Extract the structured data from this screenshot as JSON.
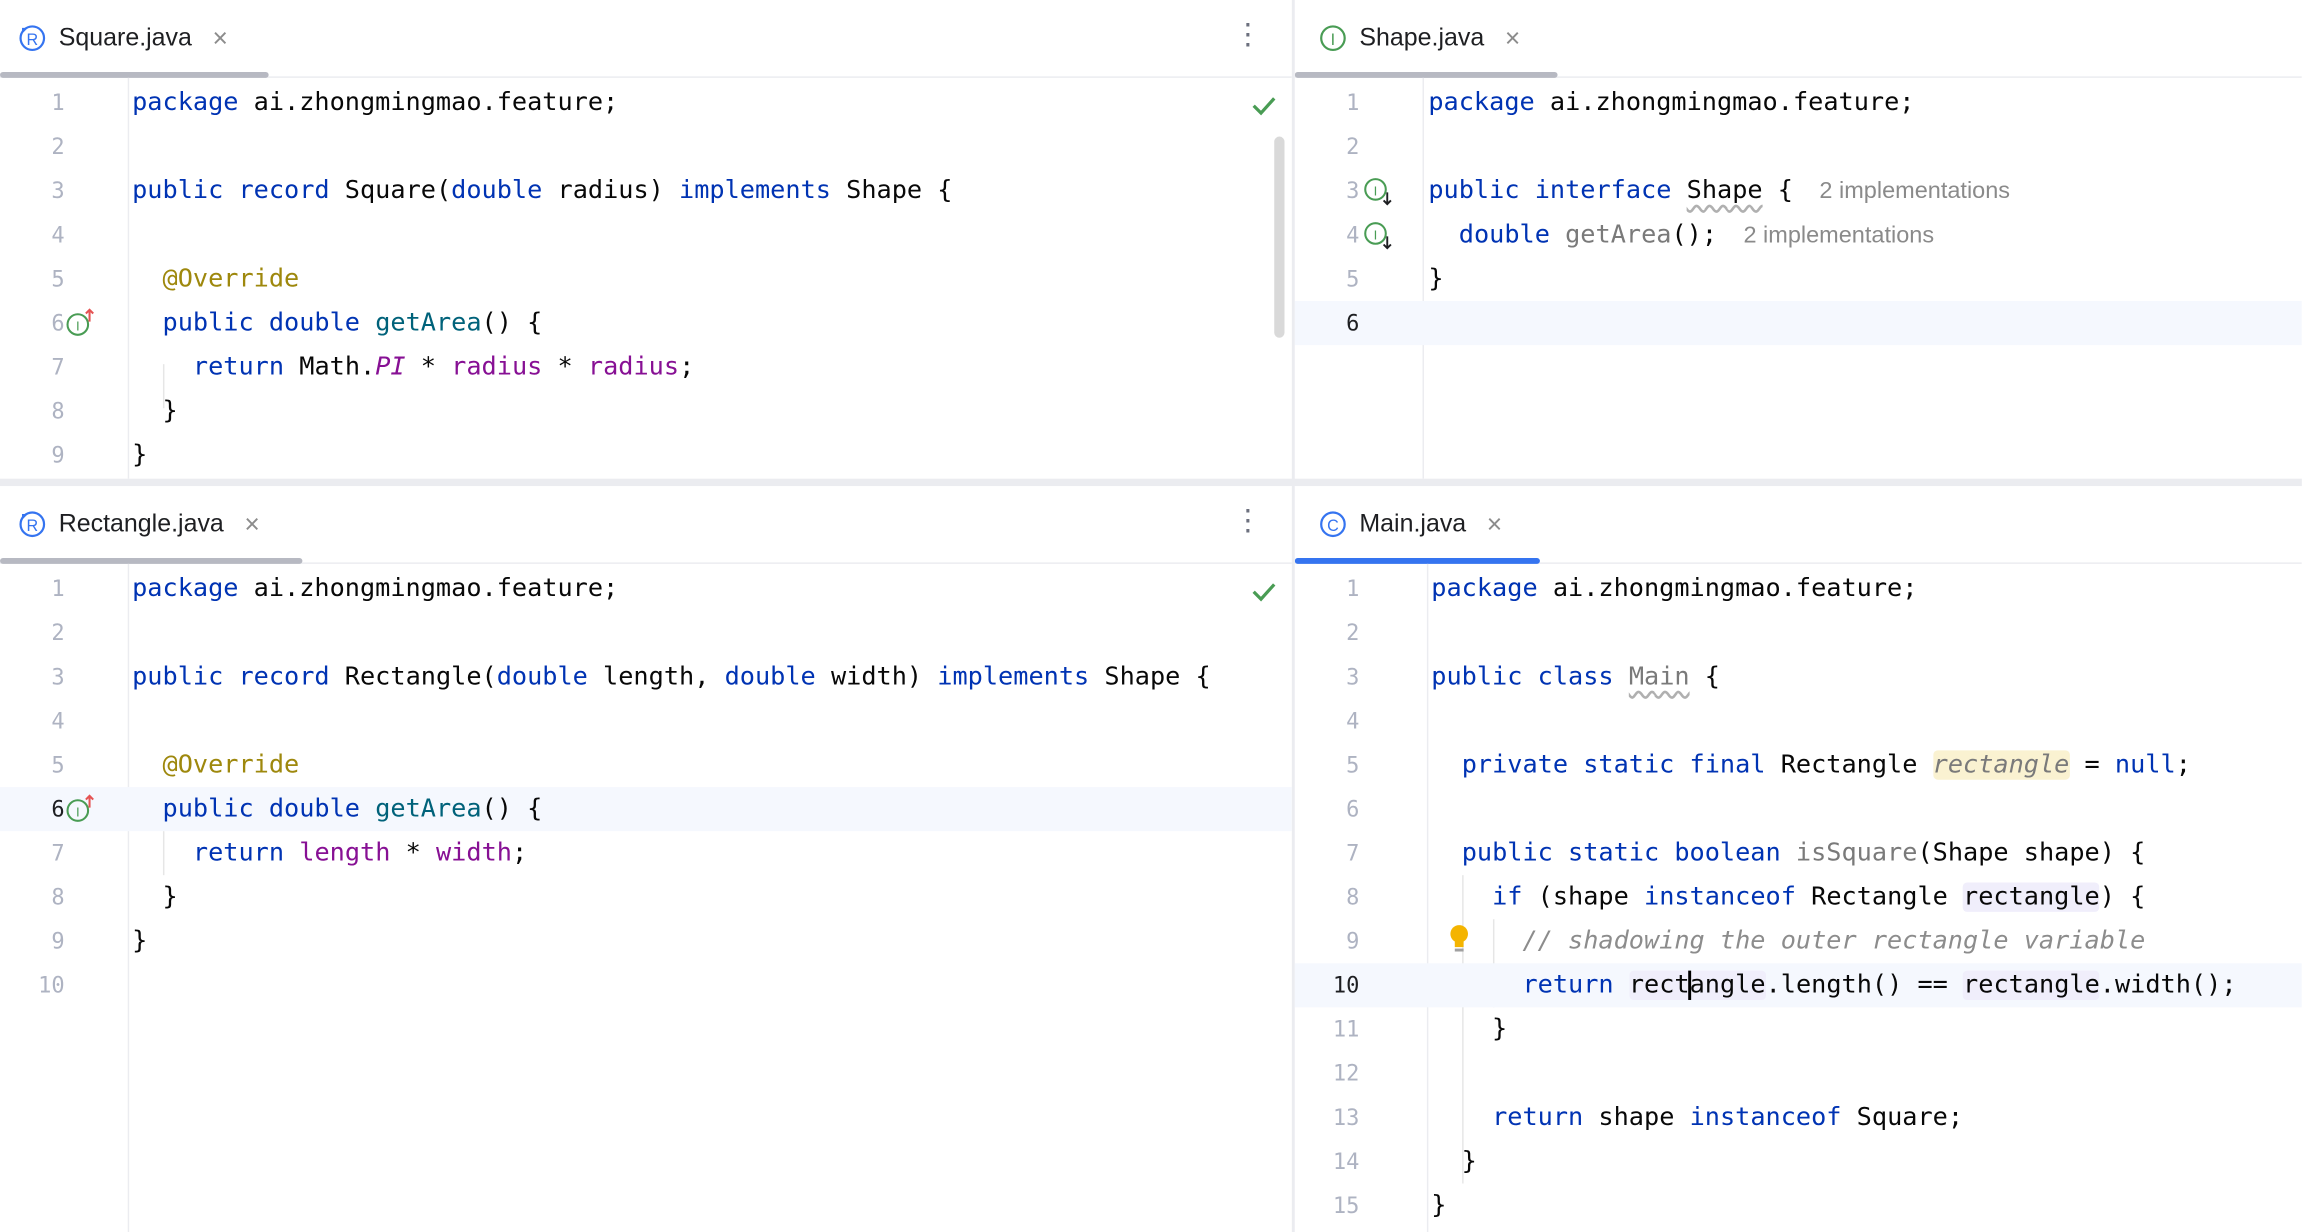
{
  "panes": {
    "square": {
      "tab_label": "Square.java",
      "tab_icon": "record-icon",
      "lines": [
        {
          "n": "1",
          "tokens": [
            [
              "kw",
              "package"
            ],
            [
              "",
              "ai.zhongmingmao.feature;"
            ]
          ]
        },
        {
          "n": "2",
          "tokens": []
        },
        {
          "n": "3",
          "tokens": [
            [
              "kw",
              "public"
            ],
            [
              "",
              "record"
            ],
            [
              "kw2",
              " "
            ],
            [
              "",
              "Square("
            ],
            [
              "kw",
              "double"
            ],
            [
              "",
              " radius) "
            ],
            [
              "kw",
              "implements"
            ],
            [
              "",
              " Shape {"
            ]
          ]
        },
        {
          "n": "4",
          "tokens": []
        },
        {
          "n": "5",
          "tokens": [
            [
              "ann",
              "  @Override"
            ]
          ]
        },
        {
          "n": "6",
          "tokens": [
            [
              "kw",
              "  public double "
            ],
            [
              "fn",
              "getArea"
            ],
            [
              "",
              "() {"
            ]
          ]
        },
        {
          "n": "7",
          "tokens": [
            [
              "kw",
              "    return "
            ],
            [
              "",
              "Math."
            ],
            [
              "ifld",
              "PI"
            ],
            [
              "",
              " * "
            ],
            [
              "fld",
              "radius"
            ],
            [
              "",
              " * "
            ],
            [
              "fld",
              "radius"
            ],
            [
              "",
              ";"
            ]
          ]
        },
        {
          "n": "8",
          "tokens": [
            [
              "",
              "  }"
            ]
          ]
        },
        {
          "n": "9",
          "tokens": [
            [
              "",
              "}"
            ]
          ]
        }
      ]
    },
    "shape": {
      "tab_label": "Shape.java",
      "tab_icon": "interface-icon",
      "implementations_hint": "2 implementations",
      "lines": [
        {
          "n": "1",
          "text": "package ai.zhongmingmao.feature;"
        },
        {
          "n": "2",
          "text": ""
        },
        {
          "n": "3",
          "text": "public interface Shape {"
        },
        {
          "n": "4",
          "text": "double getArea();"
        },
        {
          "n": "5",
          "text": "}"
        },
        {
          "n": "6",
          "text": ""
        }
      ]
    },
    "rectangle": {
      "tab_label": "Rectangle.java",
      "tab_icon": "record-icon",
      "lines": [
        {
          "n": "1",
          "text": "package ai.zhongmingmao.feature;"
        },
        {
          "n": "2",
          "text": ""
        },
        {
          "n": "3",
          "text": "public record Rectangle(double length, double width) implements Shape {"
        },
        {
          "n": "4",
          "text": ""
        },
        {
          "n": "5",
          "text": "@Override"
        },
        {
          "n": "6",
          "text": "public double getArea() {"
        },
        {
          "n": "7",
          "text": "return length * width;"
        },
        {
          "n": "8",
          "text": "}"
        },
        {
          "n": "9",
          "text": "}"
        },
        {
          "n": "10",
          "text": ""
        }
      ]
    },
    "main": {
      "tab_label": "Main.java",
      "tab_icon": "class-icon",
      "lines": [
        {
          "n": "1",
          "text": "package ai.zhongmingmao.feature;"
        },
        {
          "n": "2",
          "text": ""
        },
        {
          "n": "3",
          "text": "public class Main {"
        },
        {
          "n": "4",
          "text": ""
        },
        {
          "n": "5",
          "text": "private static final Rectangle rectangle = null;"
        },
        {
          "n": "6",
          "text": ""
        },
        {
          "n": "7",
          "text": "public static boolean isSquare(Shape shape) {"
        },
        {
          "n": "8",
          "text": "if (shape instanceof Rectangle rectangle) {"
        },
        {
          "n": "9",
          "text": "// shadowing the outer rectangle variable"
        },
        {
          "n": "10",
          "text": "return rectangle.length() == rectangle.width();"
        },
        {
          "n": "11",
          "text": "}"
        },
        {
          "n": "12",
          "text": ""
        },
        {
          "n": "13",
          "text": "return shape instanceof Square;"
        },
        {
          "n": "14",
          "text": "}"
        },
        {
          "n": "15",
          "text": "}"
        }
      ]
    }
  },
  "colors": {
    "keyword": "#0033b3",
    "method": "#00627a",
    "field": "#871094",
    "annotation": "#9e880d",
    "comment": "#8c8c8c",
    "active_tab": "#3574f0",
    "inactive_tab": "#b7b9c2",
    "check": "#499c54"
  }
}
